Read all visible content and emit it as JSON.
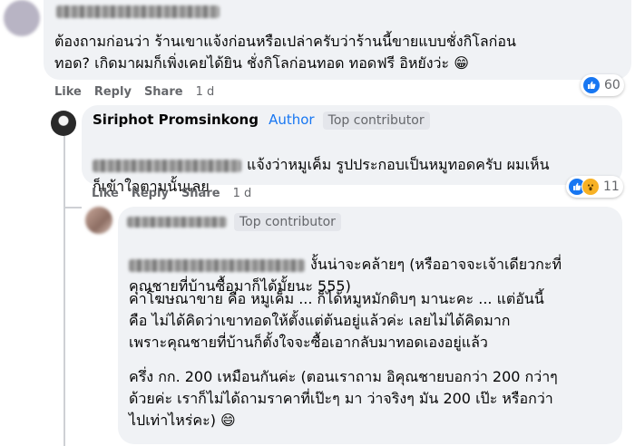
{
  "comment1": {
    "text": "ต้องถามก่อนว่า ร้านเขาแจ้งก่อนหรือเปล่าครับว่าร้านนี้ขายแบบชั่งกิโลก่อน\nทอด? เกิดมาผมก็เพิ่งเคยได้ยิน ชั่งกิโลก่อนทอด ทอดฟรี อิหยังว่ะ 😁",
    "actions": {
      "like": "Like",
      "reply": "Reply",
      "share": "Share",
      "time": "1 d"
    },
    "reactions": {
      "count": "60",
      "icons": [
        "like-icon"
      ]
    }
  },
  "comment2": {
    "author_name": "Siriphot Promsinkong",
    "author_label": "Author",
    "badge": "Top contributor",
    "text": "แจ้งว่าหมูเค็ม รูปประกอบเป็นหมูทอดครับ ผมเห็น",
    "text2": "ก็เข้าใจตามนั้นเลย",
    "actions": {
      "like": "Like",
      "reply": "Reply",
      "share": "Share",
      "time": "1 d"
    },
    "reactions": {
      "count": "11",
      "icons": [
        "like-icon",
        "wow-icon"
      ]
    }
  },
  "comment3": {
    "badge": "Top contributor",
    "para1_line1": "งั้นน่าจะคล้ายๆ (หรืออาจจะเจ้าเดียวกะที่",
    "para1_line2": "คุณชายที่บ้านซื้อมาก็ได้มั้ยนะ 555)",
    "para2": "ค่าโฆษณาขาย คือ หมูเค็ม ... ก็ได้หมูหมักดิบๆ มานะคะ ... แต่อันนี้\nคือ ไม่ได้คิดว่าเขาทอดให้ตั้งแต่ต้นอยู่แล้วค่ะ เลยไม่ได้คิดมาก\nเพราะคุณชายที่บ้านก็ตั้งใจจะซื้อเอากลับมาทอดเองอยู่แล้ว",
    "para3": "ครึ่ง กก. 200 เหมือนกันค่ะ (ตอนเราถาม อิคุณชายบอกว่า 200 กว่าๆ\nด้วยค่ะ เราก็ไม่ได้ถามราคาที่เป๊ะๆ มา ว่าจริงๆ มัน 200 เป๊ะ หรือกว่า\nไปเท่าไหร่คะ) 😄"
  },
  "colors": {
    "bubble": "#f0f2f5",
    "author": "#1877f2",
    "muted": "#65676b",
    "like": "#1877f2",
    "wow": "#f7b125"
  }
}
